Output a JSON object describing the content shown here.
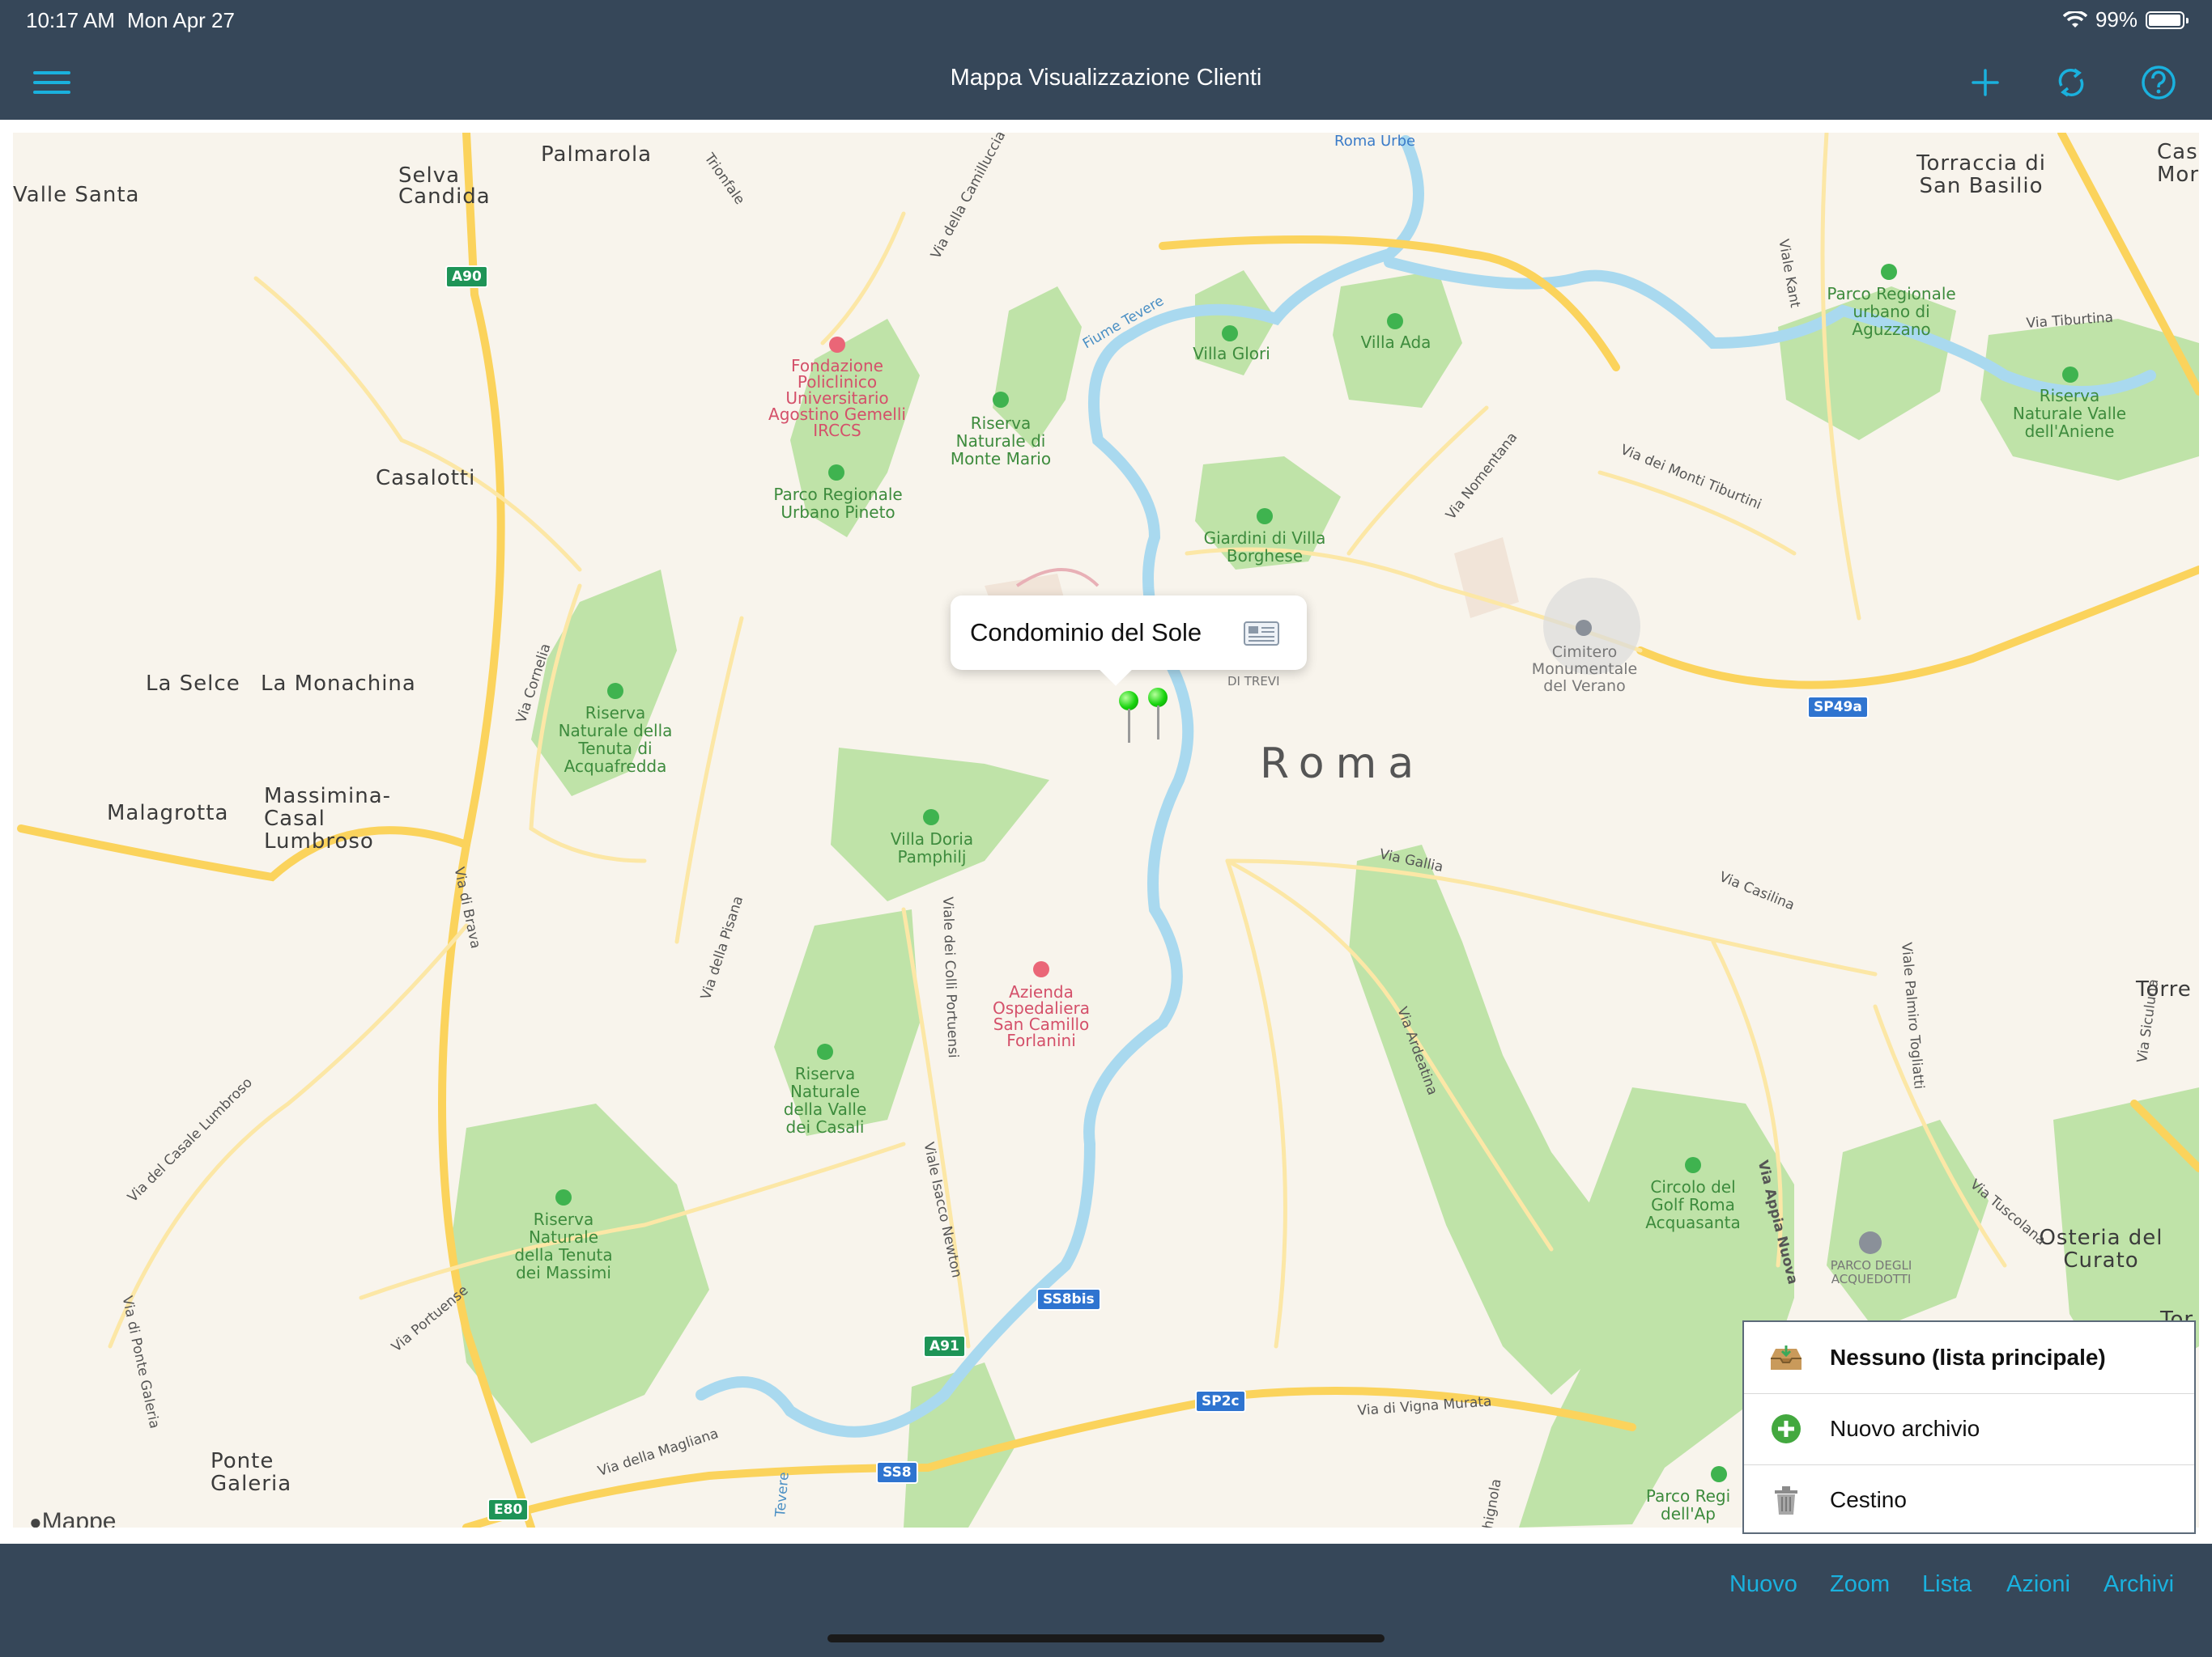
{
  "status": {
    "time": "10:17 AM",
    "date": "Mon Apr 27",
    "battery": "99%"
  },
  "nav": {
    "title": "Mappa Visualizzazione Clienti",
    "icons": [
      "hamburger-menu-icon",
      "plus-icon",
      "refresh-icon",
      "help-icon"
    ]
  },
  "map": {
    "attribution": "Mappe",
    "city": "Roma",
    "places": [
      "Valle Santa",
      "Selva Candida",
      "Palmarola",
      "Casalotti",
      "La Selce",
      "La Monachina",
      "Malagrotta",
      "Massimina-Casal Lumbroso",
      "Ponte Galeria",
      "Torraccia di San Basilio",
      "Torre",
      "Osteria del Curato",
      "Cas Mor",
      "Tor"
    ],
    "parks": [
      "Riserva Naturale di Monte Mario",
      "Parco Regionale Urbano Pineto",
      "Villa Glori",
      "Villa Ada",
      "Giardini di Villa Borghese",
      "Parco Regionale urbano di Aguzzano",
      "Riserva Naturale Valle dell'Aniene",
      "Riserva Naturale della Tenuta di Acquafredda",
      "Villa Doria Pamphilj",
      "Riserva Naturale della Valle dei Casali",
      "Riserva Naturale della Tenuta dei Massimi",
      "Circolo del Golf Roma Acquasanta",
      "Parco Regi dell'Ap"
    ],
    "hospitals": [
      "Fondazione Policlinico Universitario Agostino Gemelli IRCCS",
      "Azienda Ospedaliera San Camillo Forlanini"
    ],
    "landmarks": [
      "Cimitero Monumentale del Verano",
      "PARCO DEGLI ACQUEDOTTI",
      "Roma Urbe",
      "DI TREVI"
    ],
    "streets": [
      "Via della Camilluccia",
      "Trionfale",
      "Fiume Tevere",
      "Via dei Monti Tiburtini",
      "Via Nomentana",
      "Viale Kant",
      "Via Tiburtina",
      "Via Cornelia",
      "Via di Brava",
      "Via della Pisana",
      "Viale dei Colli Portuensi",
      "Via Gallia",
      "Via Casilina",
      "Via Ardeatina",
      "Viale Palmiro Togliatti",
      "Via Siculuna",
      "Via del Casale Lumbroso",
      "Viale Isacco Newton",
      "Via Portuense",
      "Via di Ponte Galeria",
      "Via della Magliana",
      "Via di Vigna Murata",
      "Via Appia Nuova",
      "Via Tuscolana",
      "Tevere",
      "hignola"
    ],
    "shields": [
      "A90",
      "A91",
      "E80",
      "SS8bis",
      "SS8",
      "SP2c",
      "SP49a"
    ],
    "callout": {
      "title": "Condominio del Sole",
      "icon": "newspaper-icon"
    }
  },
  "archive_menu": [
    {
      "label": "Nessuno (lista principale)",
      "icon": "inbox-tray-icon",
      "selected": true
    },
    {
      "label": "Nuovo archivio",
      "icon": "add-circle-icon",
      "selected": false
    },
    {
      "label": "Cestino",
      "icon": "trash-icon",
      "selected": false
    }
  ],
  "toolbar": {
    "items": [
      "Nuovo",
      "Zoom",
      "Lista",
      "Azioni",
      "Archivi"
    ]
  },
  "colors": {
    "bar": "#364759",
    "accent": "#1ab1de",
    "park": "#bfe3a8",
    "water": "#a9d9ef",
    "road": "#fbd35c"
  }
}
